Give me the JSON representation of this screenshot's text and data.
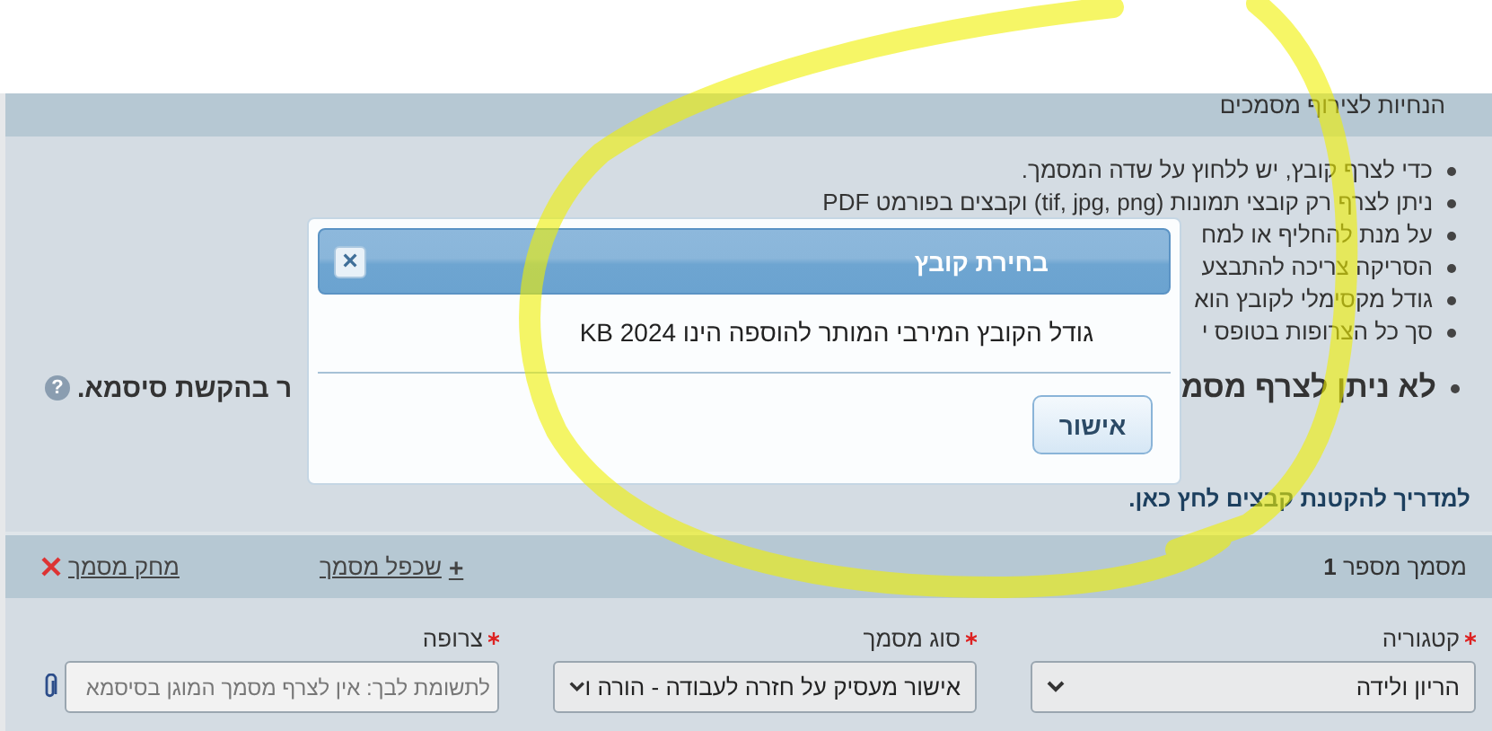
{
  "guidelines": {
    "title": "הנחיות לצירוף מסמכים",
    "items": [
      "כדי לצרף קובץ, יש ללחוץ על שדה המסמך.",
      "ניתן לצרף רק קובצי תמונות (tif, jpg, png) וקבצים בפורמט PDF",
      "על מנת להחליף או למח",
      "הסריקה צריכה להתבצע",
      "גודל מקסימלי לקובץ הוא",
      "סך כל הצרופות בטופס י"
    ],
    "warning": {
      "right": "לא ניתן לצרף מסמ",
      "left": "ר בהקשת סיסמא.",
      "help": "?"
    },
    "guide_link": "למדריך להקטנת קבצים לחץ כאן."
  },
  "document": {
    "title": "מסמך מספר **1**",
    "duplicate_icon": "+",
    "duplicate": "שכפל מסמך",
    "delete": "מחק מסמך",
    "fields": [
      {
        "kind": "select",
        "label": "קטגוריה",
        "required": true,
        "value": "הריון ולידה"
      },
      {
        "kind": "select",
        "label": "סוג מסמך",
        "required": true,
        "value": "אישור מעסיק על חזרה לעבודה - הורה ו"
      },
      {
        "kind": "file",
        "label": "צרופה",
        "required": true,
        "placeholder": "לתשומת לבך: אין לצרף מסמך המוגן בסיסמא"
      }
    ]
  },
  "dialog": {
    "title": "בחירת קובץ",
    "close": "×",
    "message": "גודל הקובץ המירבי המותר להוספה הינו KB 2024",
    "buttons": [
      "אישור"
    ]
  }
}
